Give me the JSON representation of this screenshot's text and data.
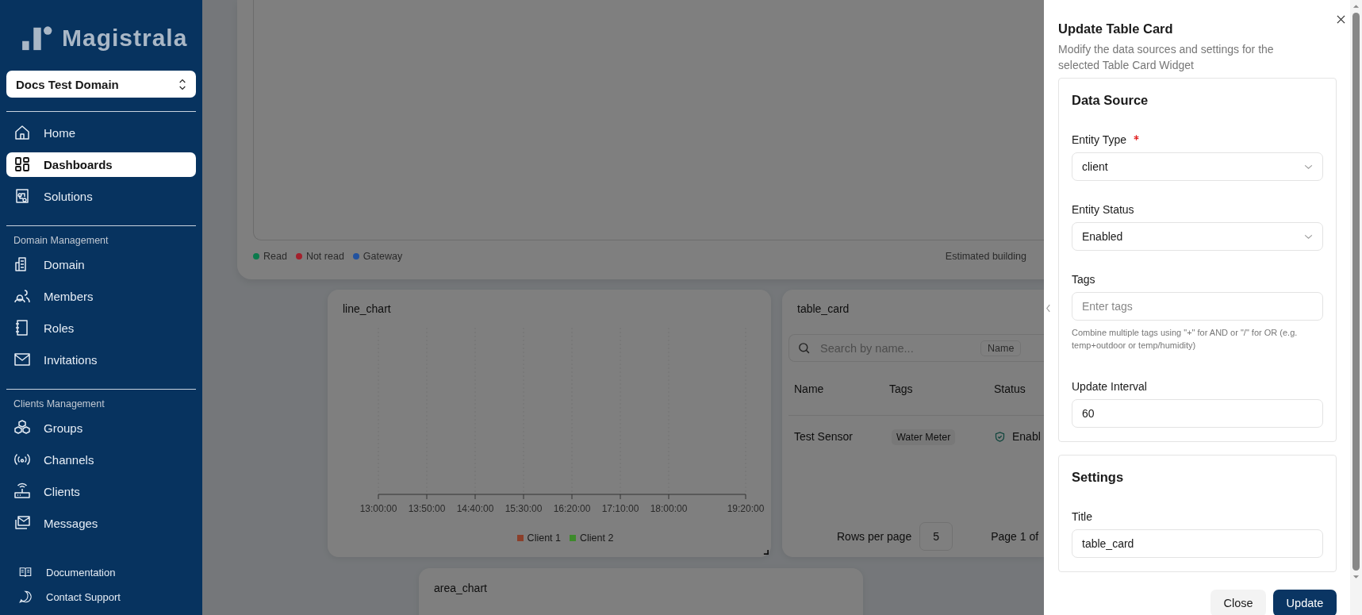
{
  "sidebar": {
    "logo": "Magistrala",
    "domain_selector": "Docs Test Domain",
    "sections": [
      {
        "items": [
          {
            "label": "Home",
            "selected": false
          },
          {
            "label": "Dashboards",
            "selected": true
          },
          {
            "label": "Solutions",
            "selected": false
          }
        ]
      },
      {
        "heading": "Domain Management",
        "items": [
          {
            "label": "Domain",
            "selected": false
          },
          {
            "label": "Members",
            "selected": false
          },
          {
            "label": "Roles",
            "selected": false
          },
          {
            "label": "Invitations",
            "selected": false
          }
        ]
      },
      {
        "heading": "Clients Management",
        "items": [
          {
            "label": "Groups",
            "selected": false
          },
          {
            "label": "Channels",
            "selected": false
          },
          {
            "label": "Clients",
            "selected": false
          },
          {
            "label": "Messages",
            "selected": false
          }
        ]
      }
    ],
    "footer_links": [
      "Documentation",
      "Contact Support"
    ]
  },
  "map_card": {
    "legend": [
      {
        "label": "Read",
        "color": "#0b7a4c"
      },
      {
        "label": "Not read",
        "color": "#a3202c"
      },
      {
        "label": "Gateway",
        "color": "#22529f"
      }
    ],
    "note": "Estimated building"
  },
  "line_chart_card": {
    "title": "line_chart",
    "x_axis_labels": [
      "13:00:00",
      "13:50:00",
      "14:40:00",
      "15:30:00",
      "16:20:00",
      "17:10:00",
      "18:00:00",
      "19:20:00"
    ],
    "legend": [
      {
        "label": "Client 1",
        "color": "#8b3f2a"
      },
      {
        "label": "Client 2",
        "color": "#3d8a2b"
      }
    ]
  },
  "table_card": {
    "title": "table_card",
    "search": {
      "placeholder": "Search by name..."
    },
    "filter": "Name",
    "columns": [
      "Name",
      "Tags",
      "Status"
    ],
    "rows": [
      {
        "name": "Test Sensor",
        "tag": "Water Meter",
        "status": "Enabl"
      }
    ],
    "rows_per_page_label": "Rows per page",
    "rows_per_page": "5",
    "page_info": "Page 1 of"
  },
  "area_chart_card": {
    "title": "area_chart"
  },
  "drawer": {
    "title": "Update Table Card",
    "description": "Modify the data sources and settings for the selected Table Card Widget",
    "sections": [
      {
        "title": "Data Source",
        "fields": [
          {
            "label": "Entity Type",
            "kind": "select",
            "value": "client",
            "required": true
          },
          {
            "label": "Entity Status",
            "kind": "select",
            "value": "Enabled",
            "required": false
          },
          {
            "label": "Tags",
            "kind": "input",
            "placeholder": "Enter tags",
            "required": false,
            "hint": "Combine multiple tags using \"+\" for AND or \"/\" for OR (e.g. temp+outdoor or temp/humidity)"
          },
          {
            "label": "Update Interval",
            "kind": "input",
            "value": "60",
            "required": false
          }
        ]
      },
      {
        "title": "Settings",
        "fields": [
          {
            "label": "Title",
            "kind": "input",
            "value": "table_card",
            "required": false
          }
        ]
      }
    ],
    "buttons": [
      {
        "label": "Close",
        "kind": "secondary"
      },
      {
        "label": "Update",
        "kind": "primary"
      }
    ]
  }
}
